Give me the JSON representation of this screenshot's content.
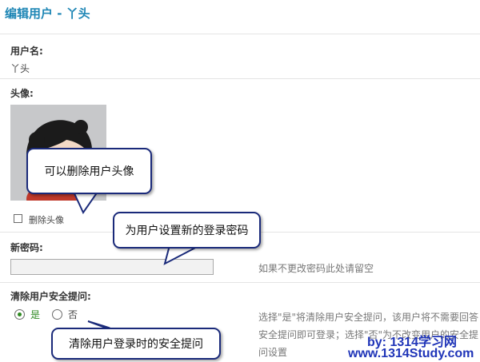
{
  "page": {
    "title": "编辑用户 - 丫头"
  },
  "fields": {
    "username": {
      "label": "用户名:",
      "value": "丫头"
    },
    "avatar": {
      "label": "头像:",
      "delete_label": "删除头像",
      "delete_checked": false
    },
    "password": {
      "label": "新密码:",
      "value": "",
      "hint": "如果不更改密码此处请留空"
    },
    "security": {
      "label": "清除用户安全提问:",
      "yes_label": "是",
      "no_label": "否",
      "selected": "是",
      "hint_line1": "选择\"是\"将清除用户安全提问，该用户将不需要回答",
      "hint_line2": "安全提问即可登录；选择\"否\"为不改变用户的安全提",
      "hint_line3": "问设置"
    }
  },
  "annotations": {
    "avatar_note": "可以删除用户头像",
    "password_note": "为用户设置新的登录密码",
    "security_note": "清除用户登录时的安全提问"
  },
  "watermark": {
    "line1": "by: 1314学习网",
    "line2": "www.1314Study.com"
  },
  "colors": {
    "title": "#1e86b5",
    "callout_border": "#1a2a7a",
    "watermark": "#1f34b8",
    "radio_yes": "#2f8a21"
  }
}
